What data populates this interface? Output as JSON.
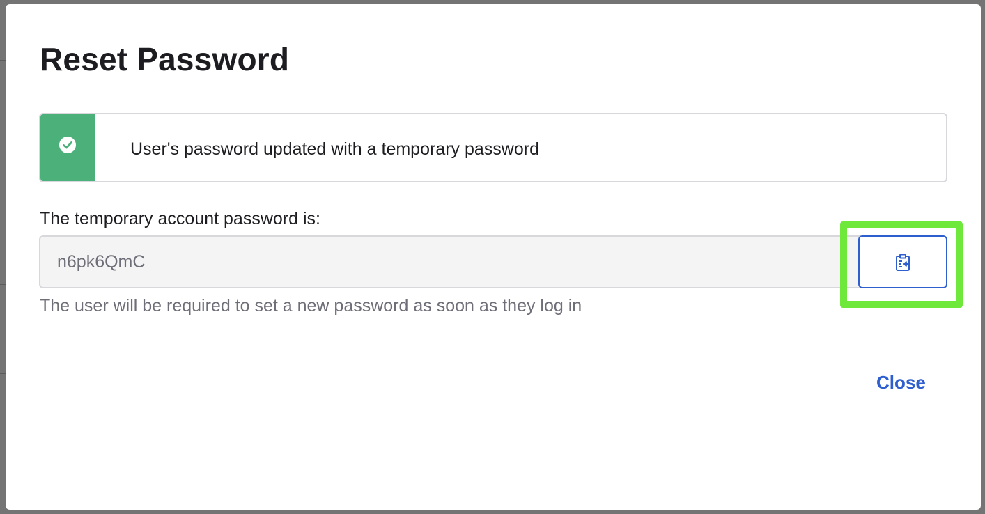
{
  "modal": {
    "title": "Reset Password",
    "banner": {
      "status": "success",
      "icon": "check-circle-icon",
      "message": "User's password updated with a temporary password",
      "accent_color": "#4cb07a"
    },
    "password_field": {
      "label": "The temporary account password is:",
      "value": "n6pk6QmC",
      "help_text": "The user will be required to set a new password as soon as they log in"
    },
    "copy_button": {
      "icon": "clipboard-copy-icon",
      "highlight_color": "#6ee83a"
    },
    "close_label": "Close",
    "link_color": "#2f5ecf"
  }
}
